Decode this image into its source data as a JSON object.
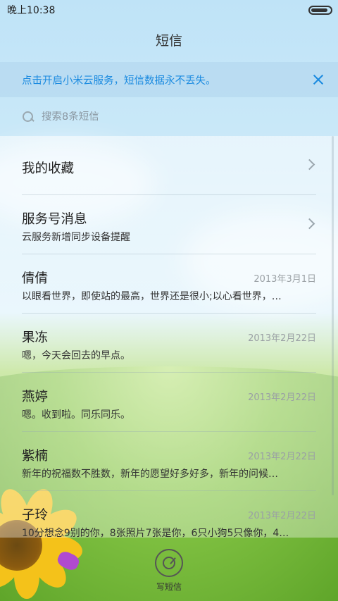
{
  "status": {
    "time": "晚上10:38",
    "battery_level": 0.9
  },
  "header": {
    "title": "短信"
  },
  "banner": {
    "text": "点击开启小米云服务，短信数据永不丢失。"
  },
  "search": {
    "placeholder": "搜索8条短信"
  },
  "list": {
    "favorites": {
      "title": "我的收藏"
    },
    "service": {
      "title": "服务号消息",
      "preview": "云服务新增同步设备提醒"
    },
    "conversations": [
      {
        "name": "倩倩",
        "date": "2013年3月1日",
        "preview": "以眼看世界，即使站的最高，世界还是很小;以心看世界，…"
      },
      {
        "name": "果冻",
        "date": "2013年2月22日",
        "preview": "嗯，今天会回去的早点。"
      },
      {
        "name": "燕婷",
        "date": "2013年2月22日",
        "preview": "嗯。收到啦。同乐同乐。"
      },
      {
        "name": "紫楠",
        "date": "2013年2月22日",
        "preview": "新年的祝福数不胜数，新年的愿望好多好多，新年的问候…"
      },
      {
        "name": "子玲",
        "date": "2013年2月22日",
        "preview": "10分想念9别的你，8张照片7张是你，6只小狗5只像你，4…"
      }
    ]
  },
  "compose": {
    "label": "写短信"
  }
}
